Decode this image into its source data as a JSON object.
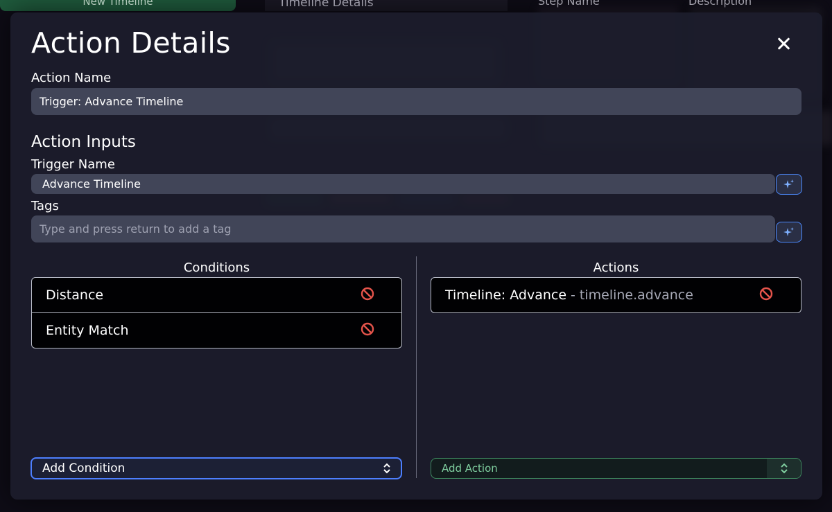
{
  "background": {
    "new_timeline_button": "New Timeline",
    "panel_title": "Timeline Details",
    "column_step_name": "Step Name",
    "column_description": "Description"
  },
  "modal": {
    "title": "Action Details",
    "close_icon": "close-icon",
    "action_name_label": "Action Name",
    "action_name_value": "Trigger: Advance Timeline",
    "action_inputs_title": "Action Inputs",
    "trigger_name_label": "Trigger Name",
    "trigger_name_value": "Advance Timeline",
    "tags_label": "Tags",
    "tags_placeholder": "Type and press return to add a tag",
    "conditions": {
      "heading": "Conditions",
      "items": [
        {
          "label": "Distance",
          "remove_icon": "prohibited-icon"
        },
        {
          "label": "Entity Match",
          "remove_icon": "prohibited-icon"
        }
      ],
      "add_select_label": "Add Condition"
    },
    "actions": {
      "heading": "Actions",
      "items": [
        {
          "label": "Timeline: Advance",
          "separator": "-",
          "id": "timeline.advance",
          "remove_icon": "prohibited-icon"
        }
      ],
      "add_select_label": "Add Action"
    }
  },
  "colors": {
    "modal_bg": "#1c1d2c",
    "input_bg": "#414558",
    "accent_blue": "#4d8bff",
    "accent_green": "#3f8a60",
    "remove_red": "#e5544b"
  }
}
